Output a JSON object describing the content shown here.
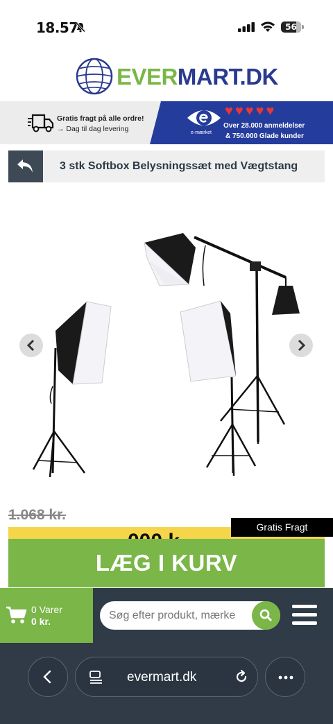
{
  "status_bar": {
    "time": "18.57",
    "battery": "56"
  },
  "logo": {
    "part1": "EVER",
    "part2": "MART",
    "part3": ".DK"
  },
  "promo": {
    "shipping_title": "Gratis fragt på alle ordre!",
    "shipping_sub": "→ Dag til dag levering",
    "emark_label": "e-mærket",
    "reviews_line1": "Over 28.000 anmeldelser",
    "reviews_line2": "& 750.000 Glade kunder",
    "heart_count": 5
  },
  "product": {
    "title": "3 stk Softbox Belysningssæt med Vægtstang",
    "old_price": "1.068 kr.",
    "new_price_partial": "000 k",
    "free_shipping_badge": "Gratis Fragt",
    "add_to_cart": "LÆG I KURV"
  },
  "site_bar": {
    "cart_items": "0 Varer",
    "cart_amount": "0 kr.",
    "search_placeholder": "Søg efter produkt, mærke"
  },
  "browser": {
    "url": "evermart.dk"
  },
  "colors": {
    "brand_green": "#7ab648",
    "brand_blue": "#2a3a8f",
    "emark_blue": "#243c9c",
    "dark_bar": "#2f3b47",
    "price_yellow": "#f5d64a"
  }
}
